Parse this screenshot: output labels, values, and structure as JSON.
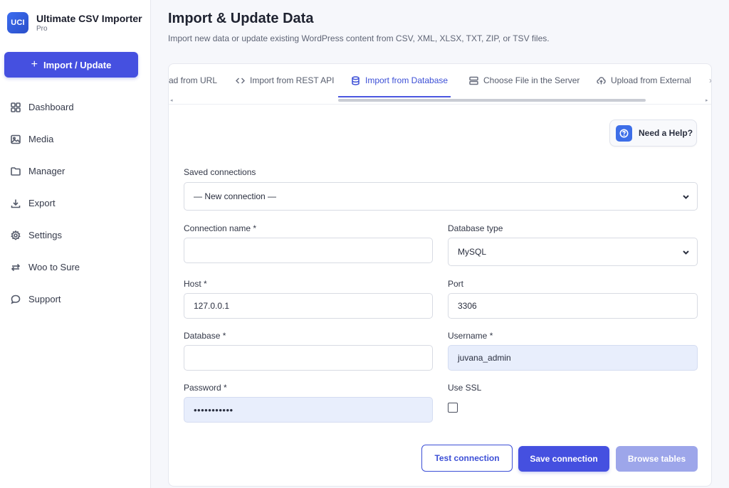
{
  "app": {
    "logo": "UCI",
    "title": "Ultimate CSV Importer",
    "subtitle": "Pro"
  },
  "sidebar": {
    "primary_button": "Import / Update",
    "items": [
      {
        "label": "Dashboard",
        "icon": "grid-icon"
      },
      {
        "label": "Media",
        "icon": "image-icon"
      },
      {
        "label": "Manager",
        "icon": "folder-icon"
      },
      {
        "label": "Export",
        "icon": "download-icon"
      },
      {
        "label": "Settings",
        "icon": "gear-icon"
      },
      {
        "label": "Woo to Sure",
        "icon": "arrows-swap-icon"
      },
      {
        "label": "Support",
        "icon": "chat-bubble-icon"
      }
    ]
  },
  "header": {
    "title": "Import & Update Data",
    "subtitle": "Import new data or update existing WordPress content from CSV, XML, XLSX, TXT, ZIP, or TSV files."
  },
  "tabs": [
    {
      "label": "ad from URL",
      "icon": ""
    },
    {
      "label": "Import from REST API",
      "icon": "code-icon"
    },
    {
      "label": "Import from Database",
      "icon": "database-icon",
      "active": true
    },
    {
      "label": "Choose File in the Server",
      "icon": "server-icon"
    },
    {
      "label": "Upload from External",
      "icon": "cloud-upload-icon"
    }
  ],
  "help_button": "Need a Help?",
  "form": {
    "saved_connections": {
      "label": "Saved connections",
      "value": "— New connection —"
    },
    "connection_name": {
      "label": "Connection name *",
      "value": ""
    },
    "database_type": {
      "label": "Database type",
      "value": "MySQL"
    },
    "host": {
      "label": "Host *",
      "value": "127.0.0.1"
    },
    "port": {
      "label": "Port",
      "value": "3306"
    },
    "database": {
      "label": "Database *",
      "value": ""
    },
    "username": {
      "label": "Username *",
      "value": "juvana_admin"
    },
    "password": {
      "label": "Password *",
      "value": "•••••••••••"
    },
    "use_ssl": {
      "label": "Use SSL",
      "checked": false
    }
  },
  "actions": {
    "test": "Test connection",
    "save": "Save connection",
    "browse": "Browse tables"
  },
  "colors": {
    "accent": "#4550e0",
    "accent_disabled": "#9da6ea",
    "autofill": "#e8eefc"
  }
}
